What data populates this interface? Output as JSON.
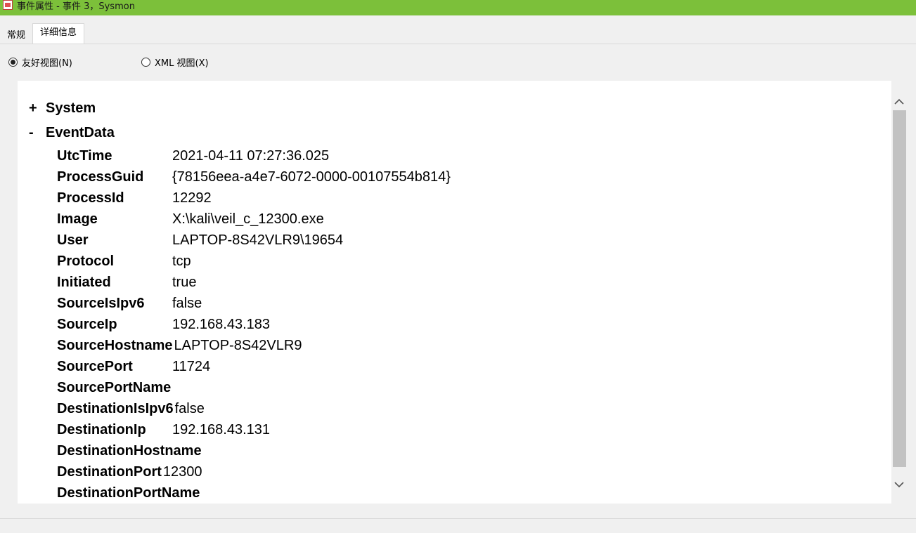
{
  "window": {
    "title": "事件属性 - 事件 3，Sysmon",
    "icon": "event-viewer-icon"
  },
  "tabs": [
    {
      "label": "常规",
      "active": false
    },
    {
      "label": "详细信息",
      "active": true
    }
  ],
  "view_options": {
    "friendly": {
      "label": "友好视图(N)",
      "checked": true
    },
    "xml": {
      "label": "XML 视图(X)",
      "checked": false
    }
  },
  "tree": {
    "system": {
      "toggle": "+",
      "label": "System"
    },
    "event_data": {
      "toggle": "-",
      "label": "EventData",
      "rows": [
        {
          "key": "UtcTime",
          "value": "2021-04-11 07:27:36.025"
        },
        {
          "key": "ProcessGuid",
          "value": "{78156eea-a4e7-6072-0000-00107554b814}"
        },
        {
          "key": "ProcessId",
          "value": "12292"
        },
        {
          "key": "Image",
          "value": "X:\\kali\\veil_c_12300.exe"
        },
        {
          "key": "User",
          "value": "LAPTOP-8S42VLR9\\19654"
        },
        {
          "key": "Protocol",
          "value": "tcp"
        },
        {
          "key": "Initiated",
          "value": "true"
        },
        {
          "key": "SourceIsIpv6",
          "value": "false"
        },
        {
          "key": "SourceIp",
          "value": "192.168.43.183"
        },
        {
          "key": "SourceHostname",
          "value": "LAPTOP-8S42VLR9"
        },
        {
          "key": "SourcePort",
          "value": "11724"
        },
        {
          "key": "SourcePortName",
          "value": ""
        },
        {
          "key": "DestinationIsIpv6",
          "value": "false"
        },
        {
          "key": "DestinationIp",
          "value": "192.168.43.131"
        },
        {
          "key": "DestinationHostname",
          "value": ""
        },
        {
          "key": "DestinationPort",
          "value": "12300"
        },
        {
          "key": "DestinationPortName",
          "value": ""
        }
      ]
    }
  },
  "scrollbar": {
    "up": "^",
    "down": "v"
  }
}
